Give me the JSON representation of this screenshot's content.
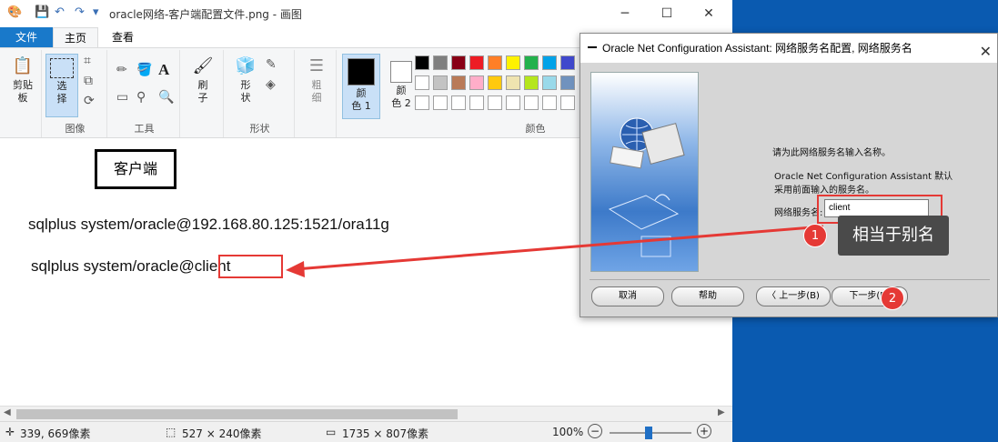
{
  "paint": {
    "window_title": "oracle网络-客户端配置文件.png - 画图",
    "tabs": {
      "file": "文件",
      "home": "主页",
      "view": "查看"
    },
    "ribbon": {
      "clipboard": {
        "label": "剪贴\n板",
        "arrow": "▾"
      },
      "image_group": {
        "select": "选\n择",
        "label": "图像"
      },
      "tools_group": {
        "label": "工具"
      },
      "brush": {
        "label": "刷\n子"
      },
      "shapes_group": {
        "shape": "形\n状",
        "label": "形状"
      },
      "size": {
        "label": "粗\n细"
      },
      "color1": {
        "label": "颜\n色 1"
      },
      "color2": {
        "label": "颜\n色 2"
      },
      "colors_group": {
        "label": "颜色"
      }
    },
    "palette": [
      "#000000",
      "#7f7f7f",
      "#880015",
      "#ed1c24",
      "#ff7f27",
      "#fff200",
      "#22b14c",
      "#00a2e8",
      "#3f48cc",
      "#ffffff",
      "#c3c3c3",
      "#b97a57",
      "#ffaec9",
      "#ffc90e",
      "#efe4b0",
      "#b5e61d",
      "#99d9ea",
      "#7092be",
      "#ffffff",
      "#ffffff",
      "#ffffff",
      "#ffffff",
      "#ffffff",
      "#ffffff",
      "#ffffff",
      "#ffffff",
      "#ffffff"
    ],
    "canvas": {
      "client_box": "客户端",
      "line1": "sqlplus system/oracle@192.168.80.125:1521/ora11g",
      "line2_prefix": "sqlplus system/oracle@",
      "line2_alias": "client"
    },
    "status": {
      "cursor": "339, 669像素",
      "selection": "527 × 240像素",
      "image_size": "1735 × 807像素",
      "zoom": "100%"
    }
  },
  "dialog": {
    "title": "Oracle Net Configuration Assistant: 网络服务名配置, 网络服务名",
    "prompt": "请为此网络服务名输入名称。",
    "info_line1": "Oracle Net Configuration Assistant 默认",
    "info_line2": "采用前面输入的服务名。",
    "field_label": "网络服务名:",
    "field_value": "client",
    "buttons": {
      "cancel": "取消",
      "help": "帮助",
      "back": "上一步(B)",
      "next": "下一步(N)"
    }
  },
  "annotations": {
    "callout": "相当于别名",
    "badge1": "1",
    "badge2": "2",
    "accent": "#e53935"
  }
}
